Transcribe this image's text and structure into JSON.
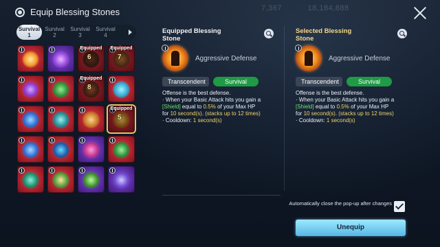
{
  "header": {
    "title": "Equip Blessing Stones"
  },
  "background_hud": [
    "7,367",
    "18,184,888"
  ],
  "tabs": [
    {
      "label": "Survival",
      "num": "1",
      "active": true
    },
    {
      "label": "Survival",
      "num": "2",
      "active": false
    },
    {
      "label": "Survival",
      "num": "3",
      "active": false
    },
    {
      "label": "Survival",
      "num": "4",
      "active": false
    }
  ],
  "stones": [
    {
      "glyph": "sun-burst",
      "frame": "red",
      "equipped": "",
      "level": "",
      "selected": false
    },
    {
      "glyph": "purple-aura",
      "frame": "purple",
      "equipped": "",
      "level": "",
      "selected": false
    },
    {
      "glyph": "dark-figure",
      "frame": "red",
      "equipped": "Equipped",
      "level": "6",
      "selected": false
    },
    {
      "glyph": "fire-figure",
      "frame": "red",
      "equipped": "Equipped",
      "level": "7",
      "selected": false
    },
    {
      "glyph": "shadow-slash",
      "frame": "red",
      "equipped": "",
      "level": "",
      "selected": false
    },
    {
      "glyph": "green-guardian",
      "frame": "red",
      "equipped": "",
      "level": "",
      "selected": false
    },
    {
      "glyph": "warrior",
      "frame": "red",
      "equipped": "Equipped",
      "level": "8",
      "selected": false
    },
    {
      "glyph": "cyan-shield",
      "frame": "red",
      "equipped": "",
      "level": "",
      "selected": false
    },
    {
      "glyph": "blue-strike",
      "frame": "red",
      "equipped": "",
      "level": "",
      "selected": false
    },
    {
      "glyph": "teal-figure",
      "frame": "red",
      "equipped": "",
      "level": "",
      "selected": false
    },
    {
      "glyph": "golden-fist",
      "frame": "red",
      "equipped": "",
      "level": "",
      "selected": false
    },
    {
      "glyph": "aggressive-defense",
      "frame": "red",
      "equipped": "Equipped",
      "level": "5",
      "selected": true
    },
    {
      "glyph": "blue-wings",
      "frame": "red",
      "equipped": "",
      "level": "",
      "selected": false
    },
    {
      "glyph": "blue-dancer",
      "frame": "red",
      "equipped": "",
      "level": "",
      "selected": false
    },
    {
      "glyph": "pink-arrow",
      "frame": "purple",
      "equipped": "",
      "level": "",
      "selected": false
    },
    {
      "glyph": "green-meditation",
      "frame": "red",
      "equipped": "",
      "level": "",
      "selected": false
    },
    {
      "glyph": "green-blade",
      "frame": "red",
      "equipped": "",
      "level": "",
      "selected": false
    },
    {
      "glyph": "tree-of-life",
      "frame": "red",
      "equipped": "",
      "level": "",
      "selected": false
    },
    {
      "glyph": "green-orb",
      "frame": "purple",
      "equipped": "",
      "level": "",
      "selected": false
    },
    {
      "glyph": "purple-claws",
      "frame": "purple",
      "equipped": "",
      "level": "",
      "selected": false
    }
  ],
  "equipped_panel": {
    "title": "Equipped Blessing Stone",
    "stone_name": "Aggressive Defense",
    "grade": "Transcendent",
    "type": "Survival",
    "desc": {
      "l1": "Offense is the best defense.",
      "l2a": "· When your Basic Attack hits you gain a",
      "l3a": "[Shield]",
      "l3b": " equal to ",
      "l3c": "0.5%",
      "l3d": " of your Max HP",
      "l4a": "for ",
      "l4b": "10 second(s)",
      "l4c": ". ",
      "l4d": "(stacks up to 12 times)",
      "l5a": "· Cooldown: ",
      "l5b": "1 second(s)"
    }
  },
  "selected_panel": {
    "title": "Selected Blessing Stone",
    "stone_name": "Aggressive Defense",
    "grade": "Transcendent",
    "type": "Survival",
    "desc": {
      "l1": "Offense is the best defense.",
      "l2a": "· When your Basic Attack hits you gain a",
      "l3a": "[Shield]",
      "l3b": " equal to ",
      "l3c": "0.5%",
      "l3d": " of your Max HP",
      "l4a": "for ",
      "l4b": "10 second(s)",
      "l4c": ". ",
      "l4d": "(stacks up to 12 times)",
      "l5a": "· Cooldown: ",
      "l5b": "1 second(s)"
    }
  },
  "autoclose": {
    "label": "Automatically close the pop-up after changes",
    "checked": true
  },
  "unequip_label": "Unequip",
  "colors": {
    "accent": "#56b8e6",
    "survival": "#1f9a45",
    "highlight": "#6ee26a",
    "value": "#f2d46a",
    "selected_title": "#f5d889"
  }
}
